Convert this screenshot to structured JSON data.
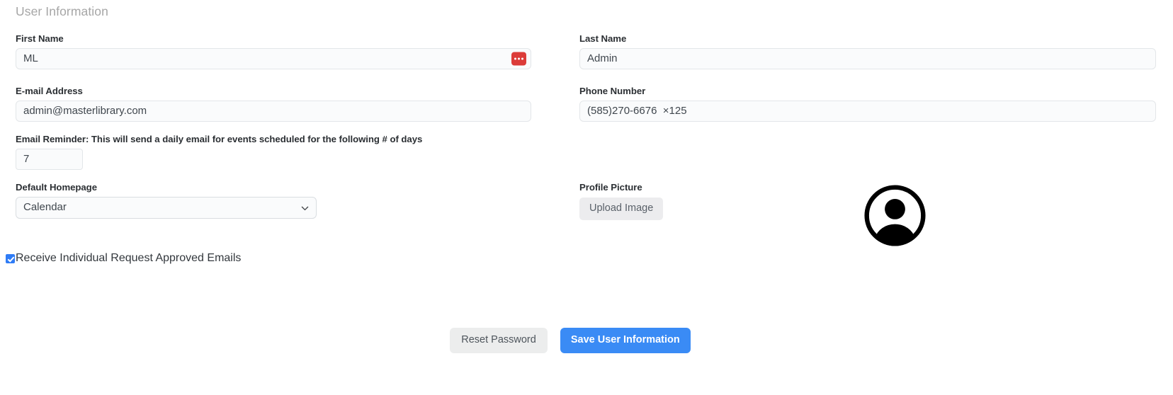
{
  "section": {
    "title": "User Information"
  },
  "fields": {
    "first_name": {
      "label": "First Name",
      "value": "ML",
      "placeholder": "First Name",
      "badge_icon": "ellipsis-icon"
    },
    "last_name": {
      "label": "Last Name",
      "value": "Admin",
      "placeholder": "Last Name"
    },
    "email": {
      "label": "E-mail Address",
      "value": "admin@masterlibrary.com",
      "placeholder": "E-mail Address"
    },
    "phone": {
      "label": "Phone Number",
      "value": "(585)270-6676  ×125",
      "placeholder": "Phone Number"
    },
    "email_reminder": {
      "label": "Email Reminder: This will send a daily email for events scheduled for the following # of days",
      "value": "7",
      "placeholder": ""
    },
    "default_homepage": {
      "label": "Default Homepage",
      "value": "Calendar",
      "options": [
        "Calendar"
      ],
      "chevron_icon": "chevron-down-icon"
    },
    "profile_picture": {
      "label": "Profile Picture",
      "upload_label": "Upload Image",
      "avatar_icon": "user-avatar-icon"
    },
    "receive_emails": {
      "label": "Receive Individual Request Approved Emails",
      "checked": true
    }
  },
  "actions": {
    "reset_password": "Reset Password",
    "save_user_information": "Save User Information"
  },
  "colors": {
    "primary": "#3a8bf5",
    "danger": "#dc3c39",
    "checkbox": "#2f7cf6",
    "input_bg": "#fafbfc",
    "secondary_btn": "#eceded"
  }
}
